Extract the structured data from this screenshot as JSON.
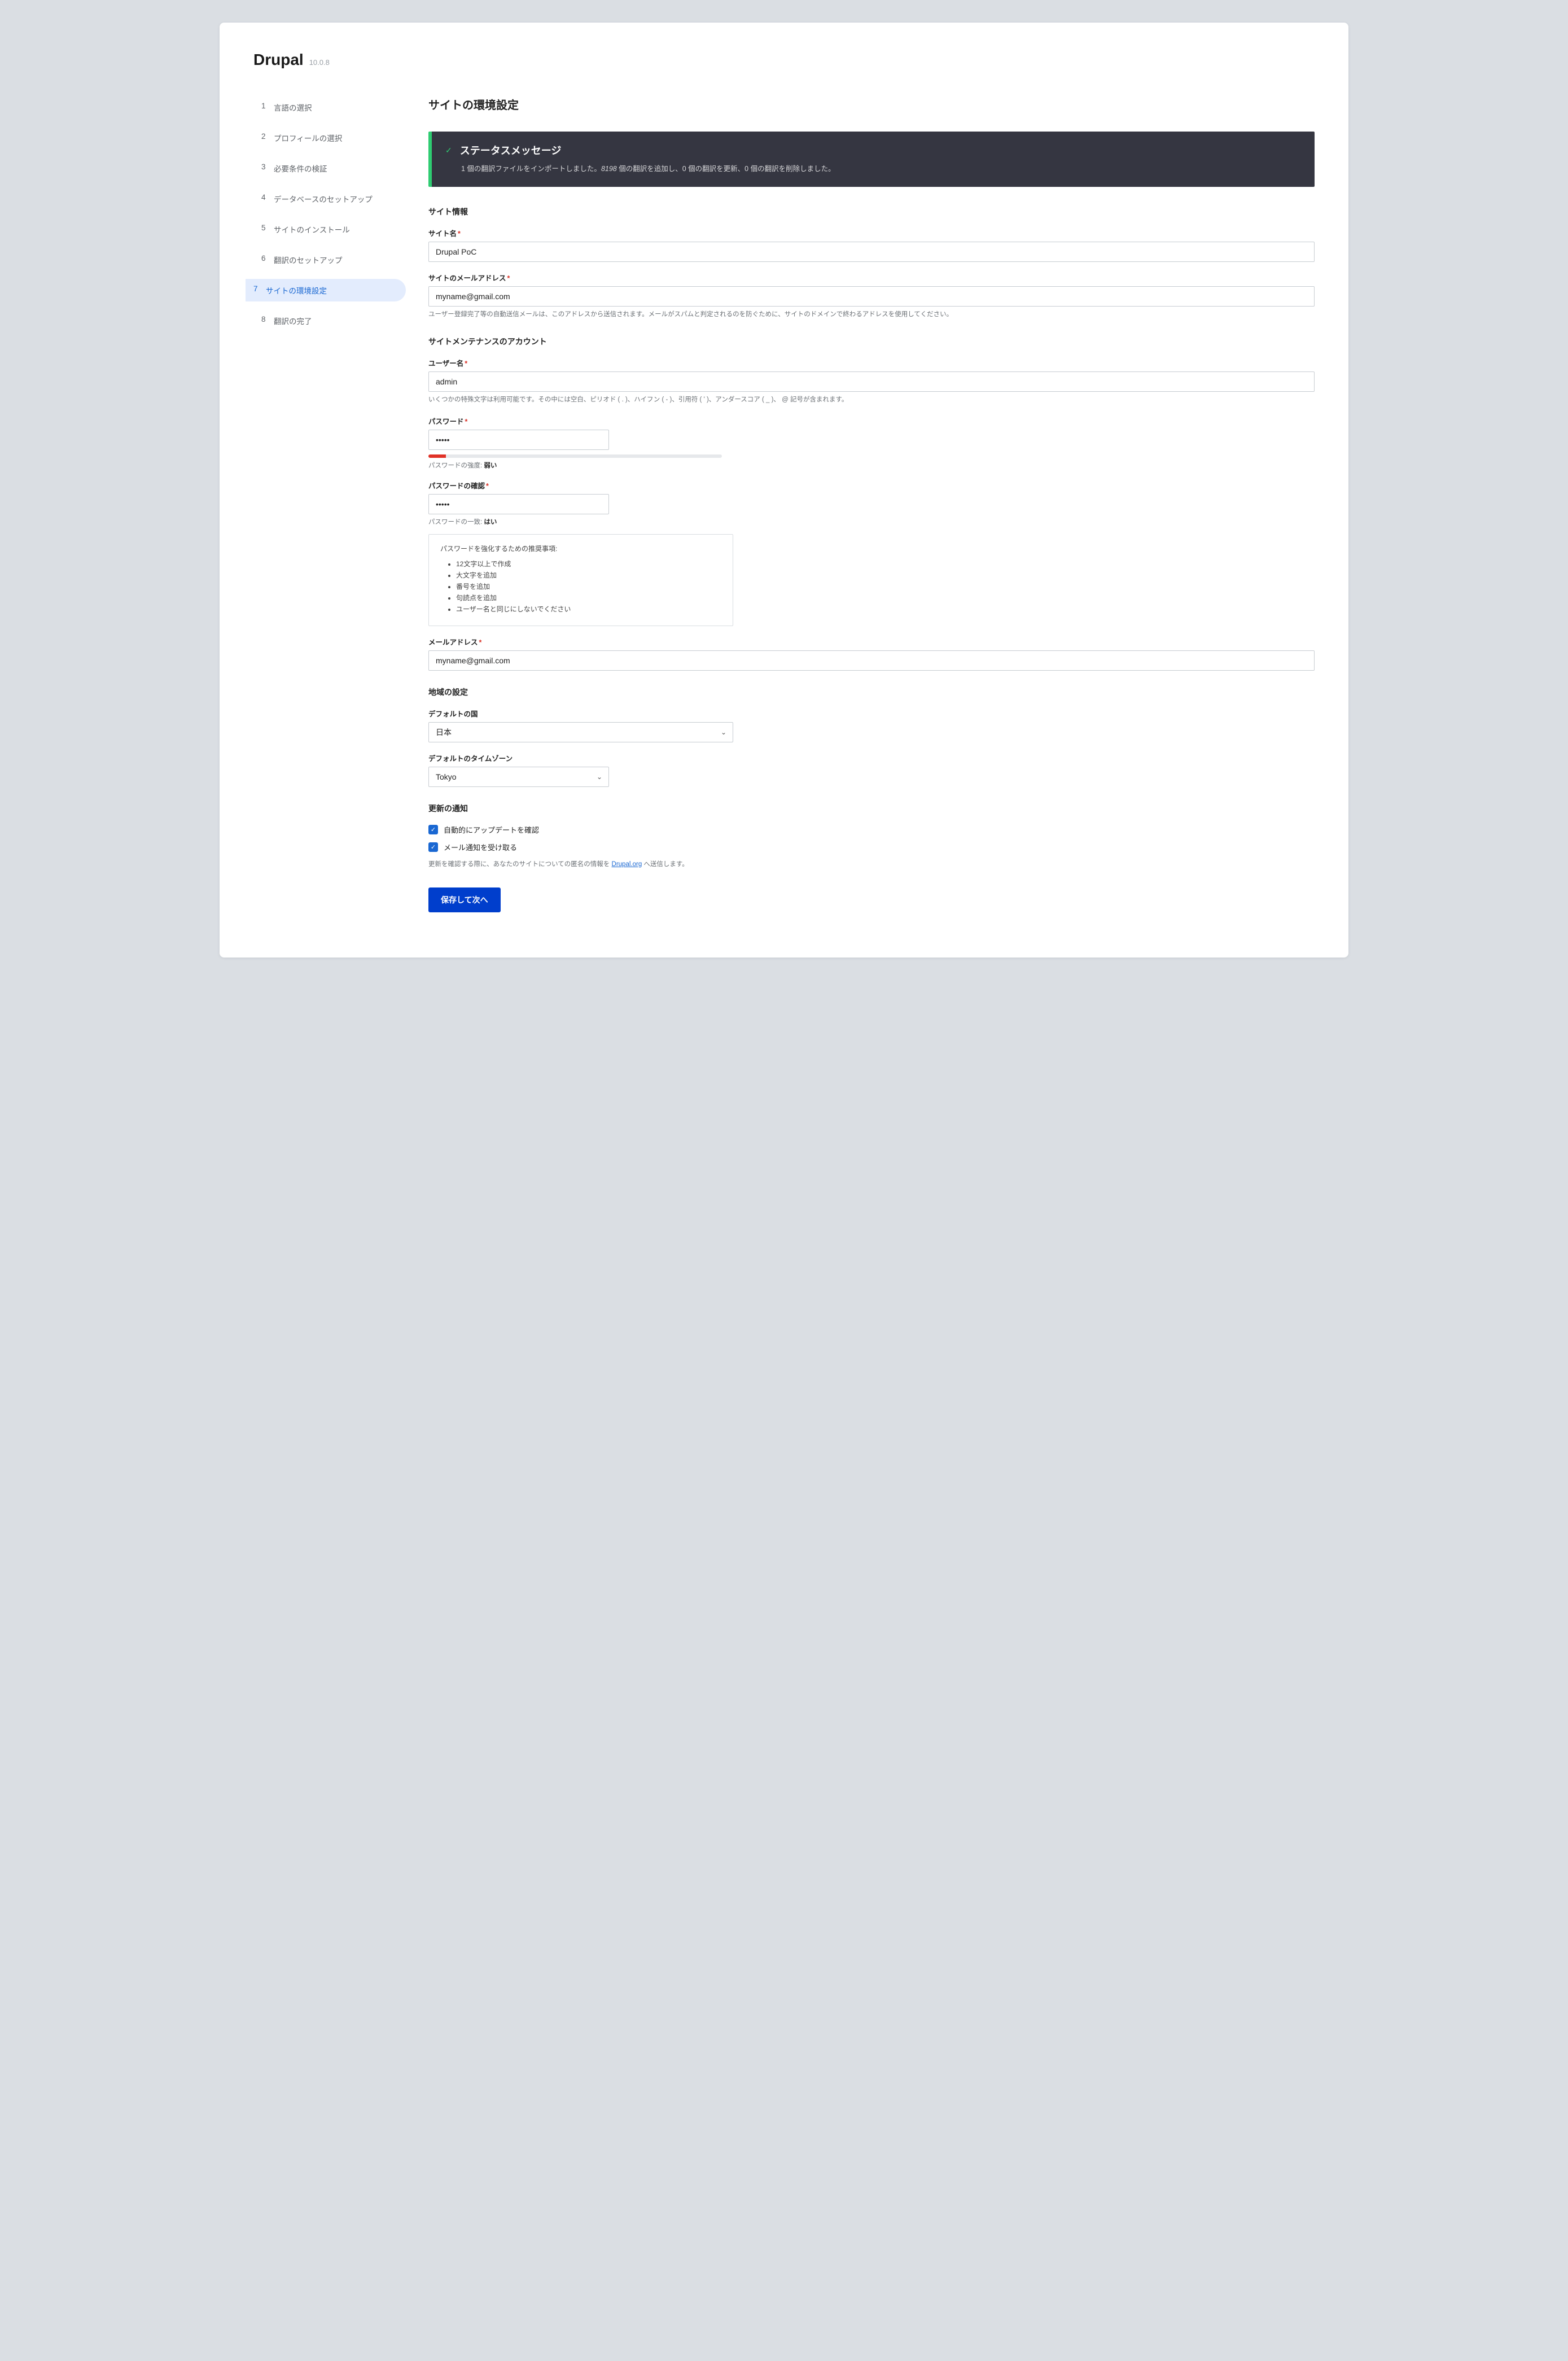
{
  "brand": {
    "name": "Drupal",
    "version": "10.0.8"
  },
  "sidebar": {
    "steps": [
      {
        "num": "1",
        "label": "言語の選択"
      },
      {
        "num": "2",
        "label": "プロフィールの選択"
      },
      {
        "num": "3",
        "label": "必要条件の検証"
      },
      {
        "num": "4",
        "label": "データベースのセットアップ"
      },
      {
        "num": "5",
        "label": "サイトのインストール"
      },
      {
        "num": "6",
        "label": "翻訳のセットアップ"
      },
      {
        "num": "7",
        "label": "サイトの環境設定"
      },
      {
        "num": "8",
        "label": "翻訳の完了"
      }
    ],
    "active_index": 6
  },
  "page_title": "サイトの環境設定",
  "status": {
    "title": "ステータスメッセージ",
    "body_prefix": "1 個の翻訳ファイルをインポートしました。",
    "body_em": "8198",
    "body_suffix": " 個の翻訳を追加し、0 個の翻訳を更新、0 個の翻訳を削除しました。"
  },
  "sections": {
    "site_info": {
      "title": "サイト情報",
      "site_name": {
        "label": "サイト名",
        "value": "Drupal PoC"
      },
      "site_email": {
        "label": "サイトのメールアドレス",
        "value": "myname@gmail.com",
        "help": "ユーザー登録完了等の自動送信メールは、このアドレスから送信されます。メールがスパムと判定されるのを防ぐために、サイトのドメインで終わるアドレスを使用してください。"
      }
    },
    "maint_account": {
      "title": "サイトメンテナンスのアカウント",
      "username": {
        "label": "ユーザー名",
        "value": "admin",
        "help": "いくつかの特殊文字は利用可能です。その中には空白、ピリオド ( . )、ハイフン ( - )、引用符 ( ' )、アンダースコア ( _ )、 @ 記号が含まれます。"
      },
      "password": {
        "label": "パスワード",
        "value": "•••••",
        "strength_label": "パスワードの強度:",
        "strength_value": "弱い",
        "meter_percent": 6
      },
      "password_confirm": {
        "label": "パスワードの確認",
        "value": "•••••",
        "match_label": "パスワードの一致:",
        "match_value": "はい"
      },
      "tips": {
        "title": "パスワードを強化するための推奨事項:",
        "items": [
          "12文字以上で作成",
          "大文字を追加",
          "番号を追加",
          "句読点を追加",
          "ユーザー名と同じにしないでください"
        ]
      },
      "email": {
        "label": "メールアドレス",
        "value": "myname@gmail.com"
      }
    },
    "regional": {
      "title": "地域の設定",
      "country": {
        "label": "デフォルトの国",
        "value": "日本"
      },
      "timezone": {
        "label": "デフォルトのタイムゾーン",
        "value": "Tokyo"
      }
    },
    "updates": {
      "title": "更新の通知",
      "check_auto": {
        "label": "自動的にアップデートを確認",
        "checked": true
      },
      "email_notify": {
        "label": "メール通知を受け取る",
        "checked": true
      },
      "note_prefix": "更新を確認する際に、あなたのサイトについての匿名の情報を ",
      "note_link": "Drupal.org",
      "note_suffix": " へ送信します。"
    }
  },
  "submit_label": "保存して次へ"
}
